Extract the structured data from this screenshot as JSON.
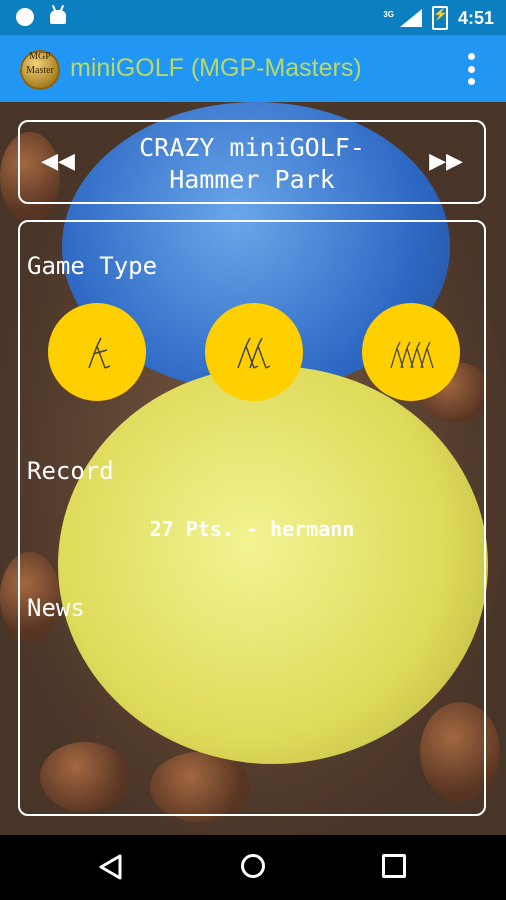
{
  "status_bar": {
    "time": "4:51",
    "network": "3G",
    "icons": [
      "notification-dot-icon",
      "android-icon",
      "signal-icon",
      "battery-charging-icon"
    ]
  },
  "app_bar": {
    "title": "miniGOLF (MGP-Masters)",
    "logo_text": "MGP\nMaster",
    "title_color": "#b9d86a",
    "bar_color": "#2196f3"
  },
  "course_selector": {
    "name": "CRAZY miniGOLF-\nHammer Park",
    "prev_icon": "rewind-icon",
    "next_icon": "fast-forward-icon"
  },
  "main": {
    "game_type_label": "Game Type",
    "game_types": [
      {
        "icon": "single-player-golfer-icon"
      },
      {
        "icon": "two-players-golfer-icon"
      },
      {
        "icon": "group-players-golfer-icon"
      }
    ],
    "game_button_color": "#ffcf00",
    "record_label": "Record",
    "record_value": "27 Pts. - hermann",
    "news_label": "News"
  },
  "nav_bar": {
    "buttons": [
      "back-icon",
      "home-icon",
      "recents-icon"
    ]
  }
}
